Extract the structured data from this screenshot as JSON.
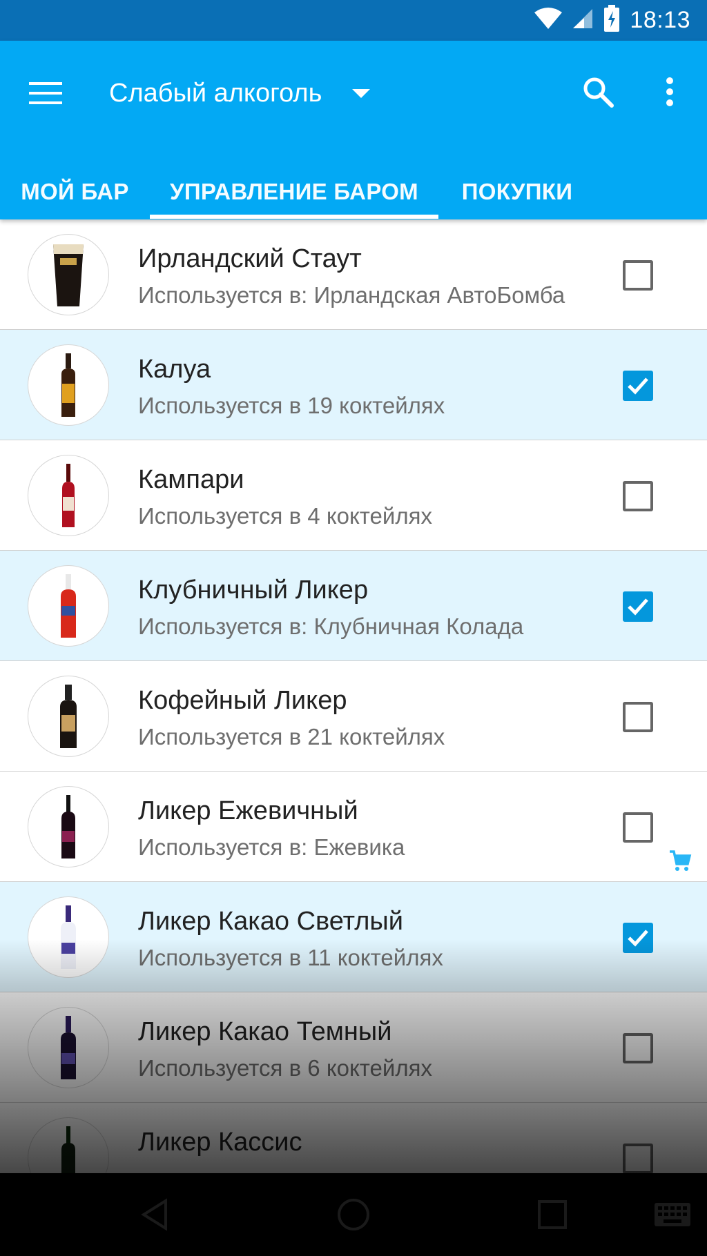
{
  "status_bar": {
    "time": "18:13",
    "icons": [
      "wifi-icon",
      "cell-signal-icon",
      "battery-charging-icon"
    ]
  },
  "app_bar": {
    "title": "Слабый алкоголь",
    "menu_icon": "menu-icon",
    "dropdown_icon": "dropdown-arrow-icon",
    "search_icon": "search-icon",
    "more_icon": "more-vert-icon",
    "color": "#03a9f4"
  },
  "tabs": [
    {
      "label": "МОЙ БАР",
      "selected": false
    },
    {
      "label": "УПРАВЛЕНИЕ БАРОМ",
      "selected": true
    },
    {
      "label": "ПОКУПКИ",
      "selected": false
    }
  ],
  "items": [
    {
      "name": "Ирландский Стаут",
      "subtitle": "Используется в: Ирландская АвтоБомба",
      "checked": false,
      "icon": "stout-glass-icon"
    },
    {
      "name": "Калуа",
      "subtitle": "Используется в 19 коктейлях",
      "checked": true,
      "icon": "bottle-icon"
    },
    {
      "name": "Кампари",
      "subtitle": "Используется в 4 коктейлях",
      "checked": false,
      "icon": "bottle-icon"
    },
    {
      "name": "Клубничный Ликер",
      "subtitle": "Используется в: Клубничная Колада",
      "checked": true,
      "icon": "bottle-icon"
    },
    {
      "name": "Кофейный Ликер",
      "subtitle": "Используется в 21 коктейлях",
      "checked": false,
      "icon": "bottle-icon"
    },
    {
      "name": "Ликер Ежевичный",
      "subtitle": "Используется в: Ежевика",
      "checked": false,
      "icon": "bottle-icon",
      "in_cart": true
    },
    {
      "name": "Ликер Какао Светлый",
      "subtitle": "Используется в 11 коктейлях",
      "checked": true,
      "icon": "bottle-icon"
    },
    {
      "name": "Ликер Какао Темный",
      "subtitle": "Используется в 6 коктейлях",
      "checked": false,
      "icon": "bottle-icon"
    },
    {
      "name": "Ликер Кассис",
      "subtitle": "",
      "checked": false,
      "icon": "bottle-icon"
    }
  ],
  "nav_bar": {
    "icons": [
      "back-icon",
      "home-icon",
      "recents-icon",
      "keyboard-icon"
    ]
  },
  "colors": {
    "accent": "#0497dc",
    "checked_row_bg": "#e1f5fe",
    "cart_icon": "#29b6f6"
  }
}
